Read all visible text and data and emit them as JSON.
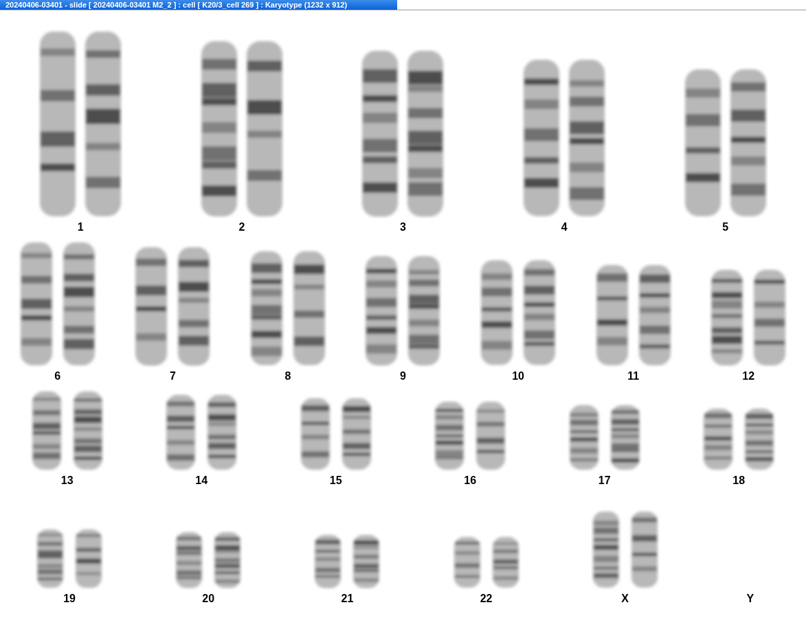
{
  "window": {
    "title": "20240406-03401 - slide [ 20240406-03401 M2_2 ] : cell [ K20/3_cell 269 ] : Karyotype  (1232 x 912)"
  },
  "rows": [
    [
      {
        "label": "1",
        "kind": "pair"
      },
      {
        "label": "2",
        "kind": "pair"
      },
      {
        "label": "3",
        "kind": "pair"
      },
      {
        "label": "4",
        "kind": "pair"
      },
      {
        "label": "5",
        "kind": "pair"
      }
    ],
    [
      {
        "label": "6",
        "kind": "pair"
      },
      {
        "label": "7",
        "kind": "pair"
      },
      {
        "label": "8",
        "kind": "pair"
      },
      {
        "label": "9",
        "kind": "pair"
      },
      {
        "label": "10",
        "kind": "pair"
      },
      {
        "label": "11",
        "kind": "pair"
      },
      {
        "label": "12",
        "kind": "pair"
      }
    ],
    [
      {
        "label": "13",
        "kind": "pair"
      },
      {
        "label": "14",
        "kind": "pair"
      },
      {
        "label": "15",
        "kind": "pair"
      },
      {
        "label": "16",
        "kind": "pair"
      },
      {
        "label": "17",
        "kind": "pair"
      },
      {
        "label": "18",
        "kind": "pair"
      }
    ],
    [
      {
        "label": "19",
        "kind": "pair"
      },
      {
        "label": "20",
        "kind": "pair"
      },
      {
        "label": "21",
        "kind": "pair"
      },
      {
        "label": "22",
        "kind": "pair"
      },
      {
        "label": "X",
        "kind": "pair"
      },
      {
        "label": "Y",
        "kind": "none"
      }
    ]
  ]
}
